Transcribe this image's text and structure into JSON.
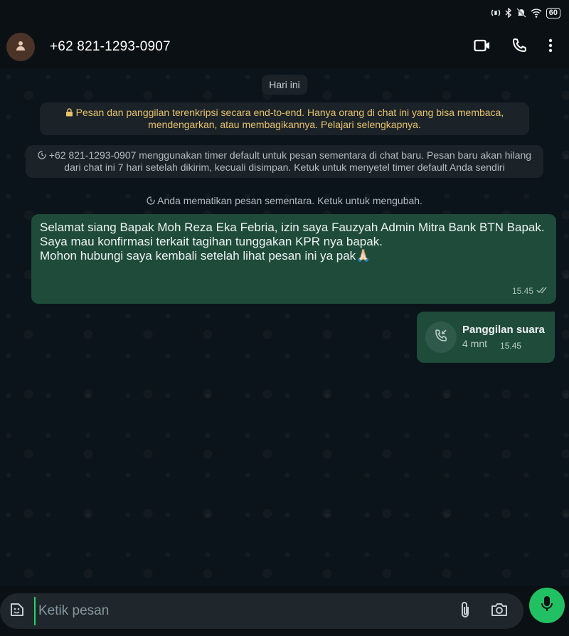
{
  "status_bar": {
    "battery": "60"
  },
  "header": {
    "contact_name": "+62 821-1293-0907",
    "icons": [
      "avatar-person-icon",
      "video-call-icon",
      "phone-icon",
      "more-vert-icon"
    ]
  },
  "chat": {
    "date_chip": "Hari ini",
    "encryption_notice": "Pesan dan panggilan terenkripsi secara end-to-end. Hanya orang di chat ini yang bisa membaca, mendengarkan, atau membagikannya. Pelajari selengkapnya.",
    "timer_notice": "+62 821-1293-0907 menggunakan timer default untuk pesan sementara di chat baru. Pesan baru akan hilang dari chat ini 7 hari setelah dikirim, kecuali disimpan. Ketuk untuk menyetel timer default Anda sendiri",
    "disappearing_off_notice": "Anda mematikan pesan sementara. Ketuk untuk mengubah.",
    "message": {
      "paragraph1": "Selamat siang Bapak Moh Reza Eka Febria, izin saya Fauzyah Admin Mitra Bank BTN Bapak.",
      "line2": "Saya mau konfirmasi terkait tagihan tunggakan KPR nya bapak.",
      "line3": "Mohon hubungi saya kembali setelah lihat pesan ini ya pak🙏🏻",
      "time": "15.45"
    },
    "call": {
      "title": "Panggilan suara",
      "duration": "4 mnt",
      "time": "15.45"
    }
  },
  "composer": {
    "placeholder": "Ketik pesan"
  }
}
